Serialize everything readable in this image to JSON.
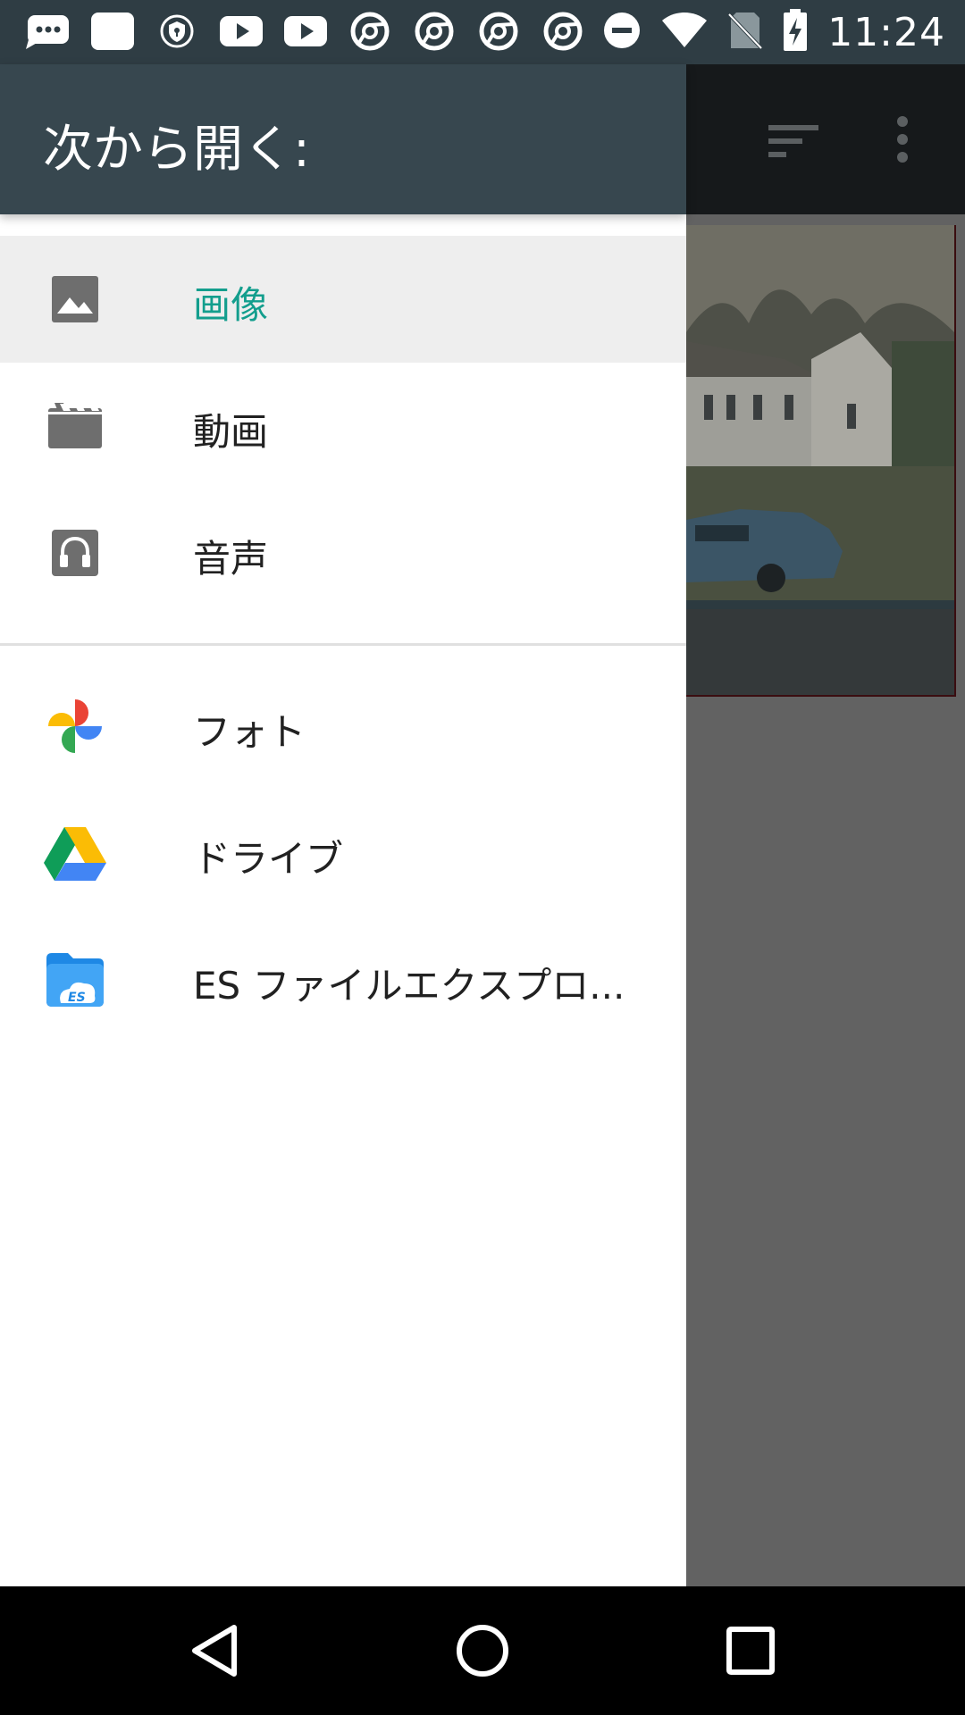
{
  "status_bar": {
    "time": "11:24",
    "notification_icons": [
      "chat-bubble-icon",
      "square-app-icon",
      "shield-icon",
      "youtube-icon",
      "youtube-icon",
      "chrome-icon",
      "chrome-icon",
      "chrome-icon",
      "chrome-icon"
    ],
    "system_icons": [
      "do-not-disturb-icon",
      "wifi-icon",
      "no-sim-icon",
      "battery-charging-icon"
    ]
  },
  "drawer": {
    "title": "次から開く:",
    "roots": [
      {
        "label": "画像",
        "icon": "image-icon",
        "selected": true
      },
      {
        "label": "動画",
        "icon": "video-clapper-icon",
        "selected": false
      },
      {
        "label": "音声",
        "icon": "headphones-icon",
        "selected": false
      }
    ],
    "apps": [
      {
        "label": "フォト",
        "icon": "google-photos-icon"
      },
      {
        "label": "ドライブ",
        "icon": "google-drive-icon"
      },
      {
        "label": "ES ファイルエクスプロ...",
        "icon": "es-file-explorer-icon"
      }
    ]
  },
  "background_app": {
    "toolbar_icons": [
      "sort-icon",
      "more-vert-icon"
    ]
  },
  "nav_bar": {
    "buttons": [
      "back-icon",
      "home-icon",
      "recents-icon"
    ]
  },
  "colors": {
    "header_bg": "#37474f",
    "status_bar_bg": "#2f3d44",
    "selected_text": "#139e8d",
    "selected_row_bg": "#eeeeee",
    "scrim": "#626262"
  }
}
